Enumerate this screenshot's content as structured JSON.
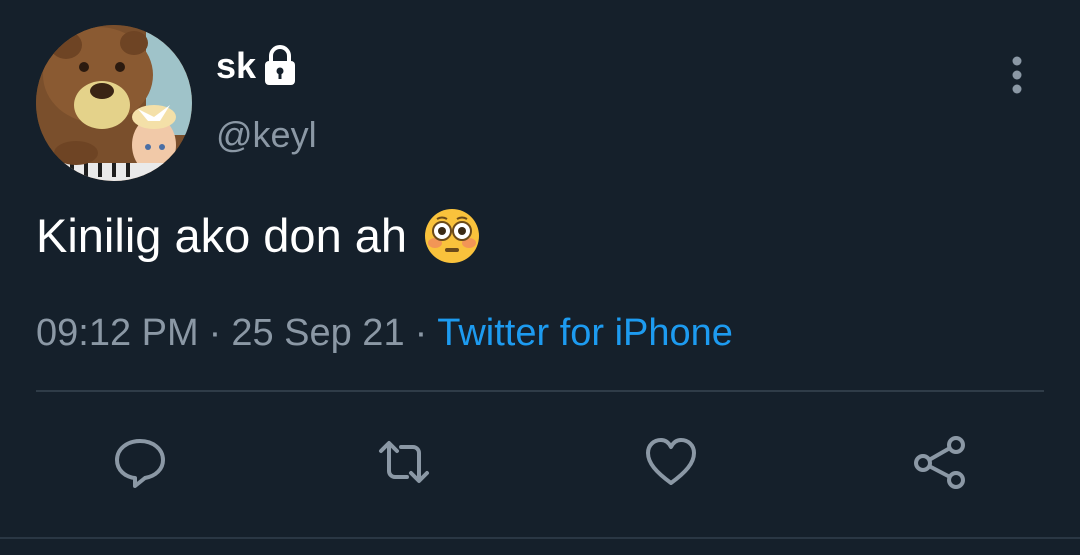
{
  "author": {
    "display_name": "sk",
    "handle": "@keyl",
    "avatar_icon": "masha-bear-avatar",
    "protected_icon": "lock-icon"
  },
  "tweet": {
    "text": "Kinilig ako don ah",
    "emoji": "flushed-face-emoji"
  },
  "meta": {
    "time": "09:12 PM",
    "separator": "·",
    "date": "25 Sep 21",
    "source": "Twitter for iPhone"
  },
  "actions": [
    {
      "name": "reply",
      "icon": "reply-icon"
    },
    {
      "name": "retweet",
      "icon": "retweet-icon"
    },
    {
      "name": "like",
      "icon": "heart-icon"
    },
    {
      "name": "share",
      "icon": "share-icon"
    }
  ],
  "colors": {
    "background": "#15202b",
    "secondary_text": "#8b98a5",
    "link": "#1d9bf0",
    "divider": "#2f3c48"
  }
}
